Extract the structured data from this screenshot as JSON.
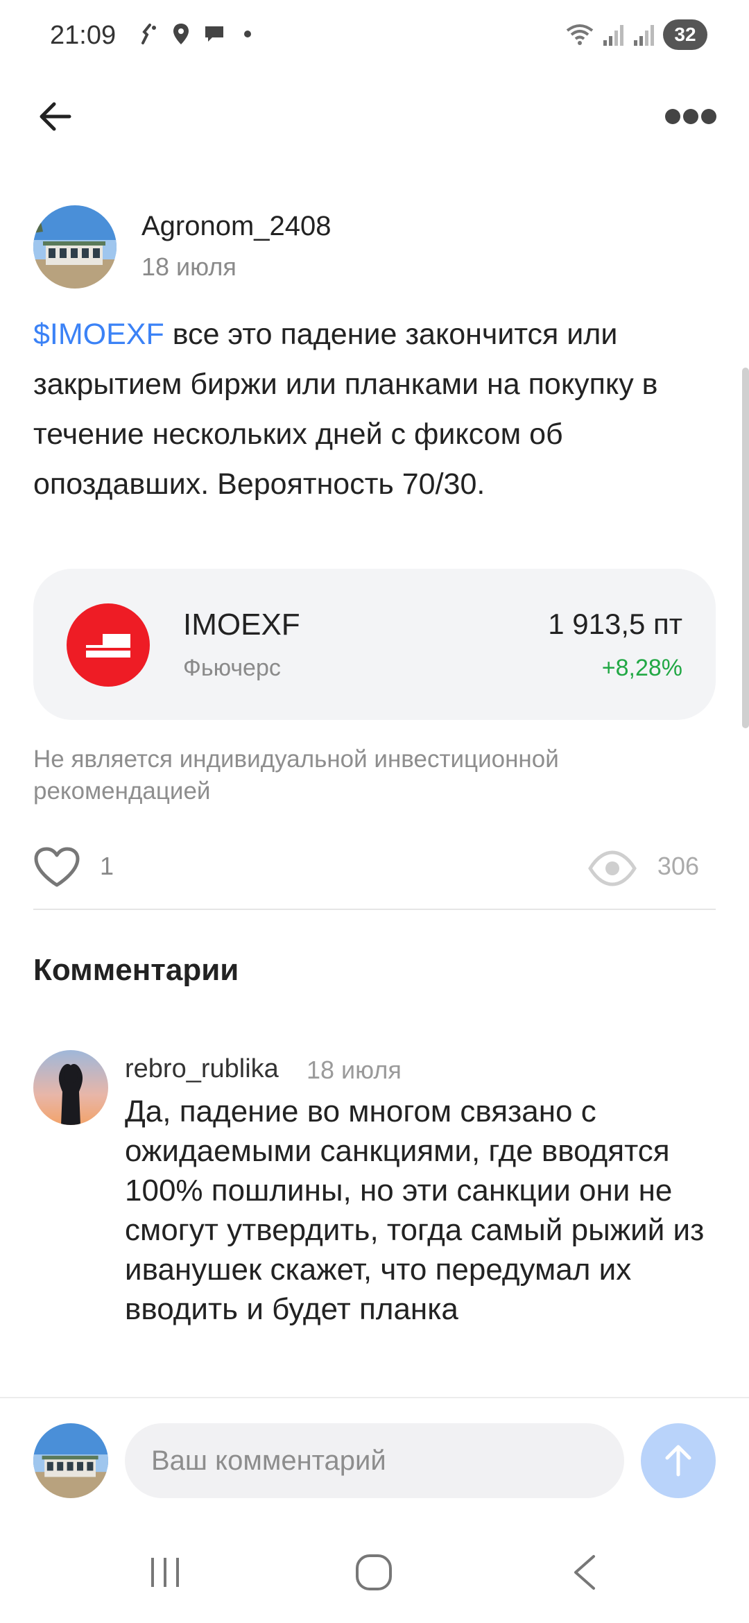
{
  "status_bar": {
    "time": "21:09",
    "battery": "32",
    "icons": [
      "phone-vibration-icon",
      "location-icon",
      "chat-icon",
      "dot-icon",
      "wifi-icon",
      "signal-icon",
      "signal-icon",
      "battery-icon"
    ]
  },
  "app_bar": {
    "back_icon": "arrow-left-icon",
    "more_icon": "more-dots-icon"
  },
  "post": {
    "author": "Agronom_2408",
    "date": "18 июля",
    "ticker": "$IMOEXF",
    "text": " все это падение закончится или закрытием биржи или планками на покупку в течение нескольких дней с фиксом об опоздавших. Вероятность 70/30.",
    "instrument": {
      "name": "IMOEXF",
      "type": "Фьючерс",
      "price": "1 913,5 пт",
      "change": "+8,28%",
      "logo_color": "#ee1c25",
      "change_color": "#22a845"
    },
    "disclaimer": "Не является индивидуальной инвестиционной рекомендацией",
    "likes": "1",
    "views": "306"
  },
  "comments": {
    "title": "Комментарии",
    "items": [
      {
        "author": "rebro_rublika",
        "date": "18 июля",
        "text": "Да, падение во многом связано с ожидаемыми санкциями, где вводятся 100% пошлины, но эти санкции они не смогут утвердить, тогда самый рыжий из иванушек скажет, что передумал их вводить и будет планка"
      }
    ]
  },
  "input": {
    "placeholder": "Ваш комментарий",
    "send_icon": "arrow-up-icon"
  },
  "colors": {
    "link": "#3b82f6",
    "positive": "#22a845",
    "send_button": "#b9d3fa"
  }
}
